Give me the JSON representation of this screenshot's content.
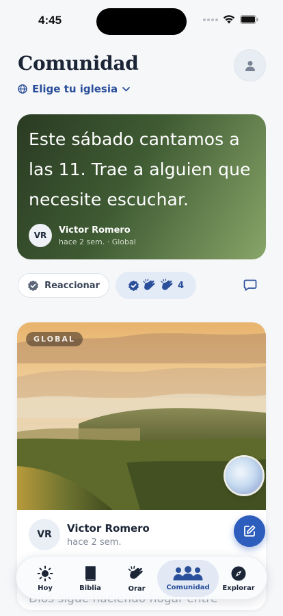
{
  "status": {
    "time": "4:45"
  },
  "header": {
    "title": "Comunidad",
    "church_select": "Elige tu iglesia"
  },
  "quote_post": {
    "text": "Este sábado cantamos a las 11. Trae a alguien que necesite escuchar.",
    "author_initials": "VR",
    "author": "Victor Romero",
    "meta": "hace 2 sem. · Global"
  },
  "reactions": {
    "react_label": "Reaccionar",
    "count": "4"
  },
  "image_post": {
    "tag": "GLOBAL",
    "author_initials": "VR",
    "author": "Victor Romero",
    "time": "hace 2 sem.",
    "body_preview": "Dios sigue haciendo hogar entre"
  },
  "tabs": [
    {
      "label": "Hoy",
      "icon": "sun-icon"
    },
    {
      "label": "Biblia",
      "icon": "bible-icon"
    },
    {
      "label": "Orar",
      "icon": "praying-hands-icon"
    },
    {
      "label": "Comunidad",
      "icon": "people-icon",
      "active": true
    },
    {
      "label": "Explorar",
      "icon": "compass-icon"
    }
  ],
  "colors": {
    "accent": "#2a4f9a",
    "fab": "#2d5dbd",
    "title": "#1b2536"
  }
}
